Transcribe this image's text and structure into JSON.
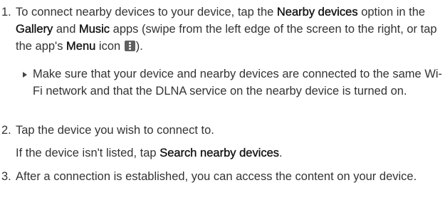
{
  "steps": [
    {
      "number": "1.",
      "text": {
        "t1": "To connect nearby devices to your device, tap the ",
        "b1": "Nearby devices",
        "t2": " option in the ",
        "b2": "Gallery",
        "t3": " and ",
        "b3": "Music",
        "t4": " apps (swipe from the left edge of the screen to the right, or tap the app's ",
        "b4": "Menu",
        "t5": " icon ",
        "t6": ")."
      },
      "note": "Make sure that your device and nearby devices are connected to the same Wi-Fi network and that the DLNA service on the nearby device is turned on."
    },
    {
      "number": "2.",
      "text": "Tap the device you wish to connect to.",
      "followup": {
        "t1": "If the device isn't listed, tap ",
        "b1": "Search nearby devices",
        "t2": "."
      }
    },
    {
      "number": "3.",
      "text": "After a connection is established, you can access the content on your device."
    }
  ],
  "icons": {
    "menu": "vertical-ellipsis-menu-icon",
    "bullet": "right-triangle-bullet-icon"
  },
  "colors": {
    "text": "#333333",
    "emphasis": "#111111",
    "icon_bg": "#606060"
  }
}
